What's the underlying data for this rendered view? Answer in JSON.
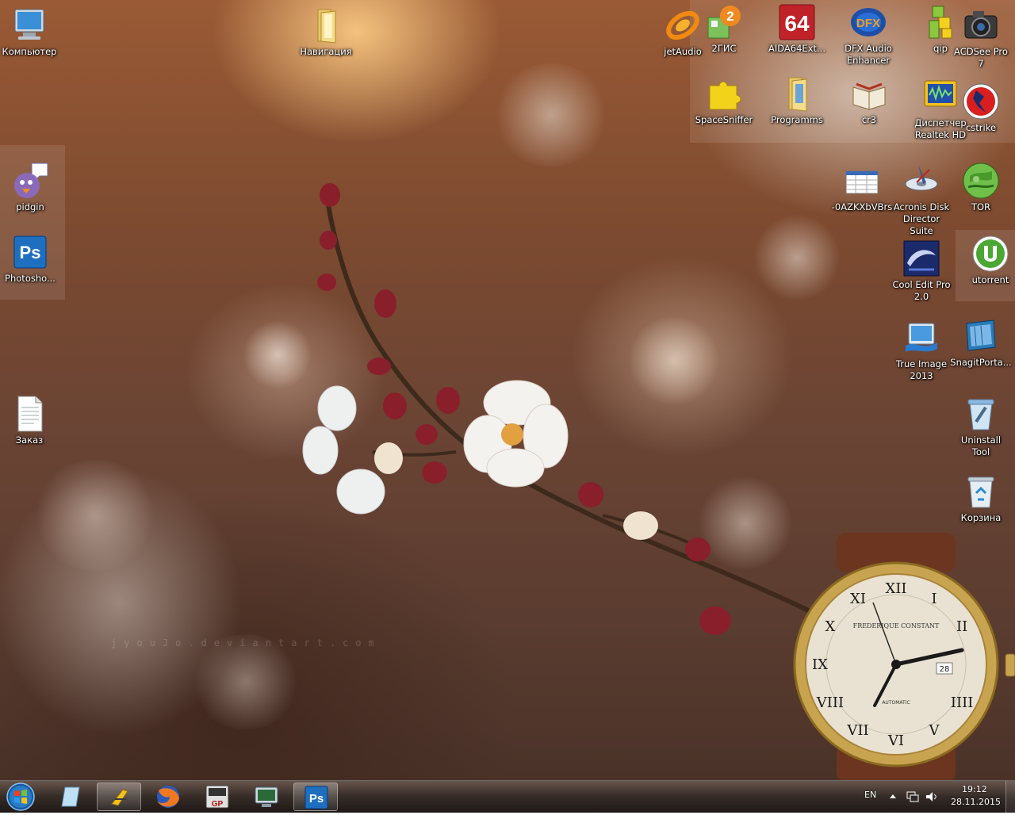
{
  "desktop": {
    "watermark": "jyouJo.deviantart.com",
    "icons": [
      {
        "name": "Компьютер",
        "icon": "computer-icon"
      },
      {
        "name": "Навигация",
        "icon": "folder-icon"
      },
      {
        "name": "jetAudio",
        "icon": "jetaudio-icon"
      },
      {
        "name": "2ГИС",
        "icon": "2gis-icon",
        "badge": "2"
      },
      {
        "name": "AIDA64Ext...",
        "icon": "aida64-icon",
        "badge": "64"
      },
      {
        "name": "DFX Audio\nEnhancer",
        "icon": "dfx-icon",
        "badge": "DFX"
      },
      {
        "name": "qip",
        "icon": "qip-icon"
      },
      {
        "name": "ACDSee Pro\n7",
        "icon": "camera-icon"
      },
      {
        "name": "SpaceSniffer",
        "icon": "puzzle-icon"
      },
      {
        "name": "Programms",
        "icon": "folder-icon"
      },
      {
        "name": "cr3",
        "icon": "book-icon"
      },
      {
        "name": "Диспетчер\nRealtek HD",
        "icon": "realtek-icon"
      },
      {
        "name": "cstrike",
        "icon": "counter-strike-icon"
      },
      {
        "name": "pidgin",
        "icon": "pidgin-icon"
      },
      {
        "name": "Photosho...",
        "icon": "photoshop-icon",
        "badge": "Ps"
      },
      {
        "name": "-0AZKXbVBrs",
        "icon": "spreadsheet-icon"
      },
      {
        "name": "Acronis Disk\nDirector Suite",
        "icon": "acronis-icon"
      },
      {
        "name": "TOR",
        "icon": "tor-icon"
      },
      {
        "name": "Cool Edit Pro\n2.0",
        "icon": "cooledit-icon"
      },
      {
        "name": "utorrent",
        "icon": "utorrent-icon"
      },
      {
        "name": "True Image\n2013",
        "icon": "trueimage-icon"
      },
      {
        "name": "SnagitPorta...",
        "icon": "snagit-icon"
      },
      {
        "name": "Uninstall\nTool",
        "icon": "uninstall-tool-icon"
      },
      {
        "name": "Корзина",
        "icon": "recycle-bin-icon"
      },
      {
        "name": "Заказ",
        "icon": "text-document-icon"
      }
    ]
  },
  "gadget_clock": {
    "brand": "FREDERIQUE CONSTANT",
    "sub": "AUTOMATIC",
    "date": "28",
    "numerals": [
      "XII",
      "I",
      "II",
      "III",
      "IIII",
      "V",
      "VI",
      "VII",
      "VIII",
      "IX",
      "X",
      "XI"
    ],
    "time_shown": "19:12"
  },
  "taskbar": {
    "start": "start-orb-icon",
    "pinned": [
      {
        "name": "show-desktop-icon"
      },
      {
        "name": "jetaudio-icon",
        "open": true
      },
      {
        "name": "firefox-icon"
      },
      {
        "name": "guitar-pro-icon",
        "badge": "GP"
      },
      {
        "name": "monitor-app-icon"
      },
      {
        "name": "photoshop-icon",
        "badge": "Ps"
      }
    ],
    "tray": {
      "language": "EN",
      "time": "19:12",
      "date": "28.11.2015"
    }
  },
  "colors": {
    "ps_blue": "#1e6fc0",
    "tor_green": "#6fbf4a",
    "utorrent_green": "#4aa832",
    "taskbar": "#2b221d"
  }
}
